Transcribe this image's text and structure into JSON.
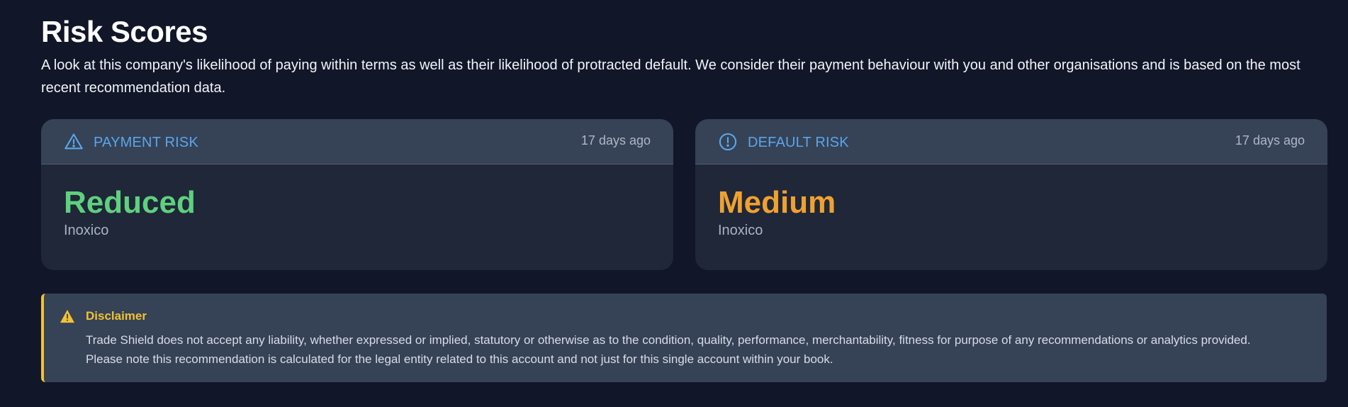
{
  "header": {
    "title": "Risk Scores",
    "description": "A look at this company's likelihood of paying within terms as well as their likelihood of protracted default. We consider their payment behaviour with you and other organisations and is based on the most recent recommendation data."
  },
  "cards": [
    {
      "icon": "warning-triangle-icon",
      "label": "PAYMENT RISK",
      "time": "17 days ago",
      "score": "Reduced",
      "score_color": "#5fd07e",
      "entity": "Inoxico"
    },
    {
      "icon": "alert-circle-icon",
      "label": "DEFAULT RISK",
      "time": "17 days ago",
      "score": "Medium",
      "score_color": "#efa130",
      "entity": "Inoxico"
    }
  ],
  "disclaimer": {
    "icon": "warning-filled-icon",
    "title": "Disclaimer",
    "text": "Trade Shield does not accept any liability, whether expressed or implied, statutory or otherwise as to the condition, quality, performance, merchantability, fitness for purpose of any recommendations or analytics provided. Please note this recommendation is calculated for the legal entity related to this account and not just for this single account within your book."
  },
  "colors": {
    "background": "#111628",
    "card_body": "#1f2739",
    "card_header": "#364256",
    "accent_blue": "#5aa6ea",
    "warning_yellow": "#f1c232"
  }
}
